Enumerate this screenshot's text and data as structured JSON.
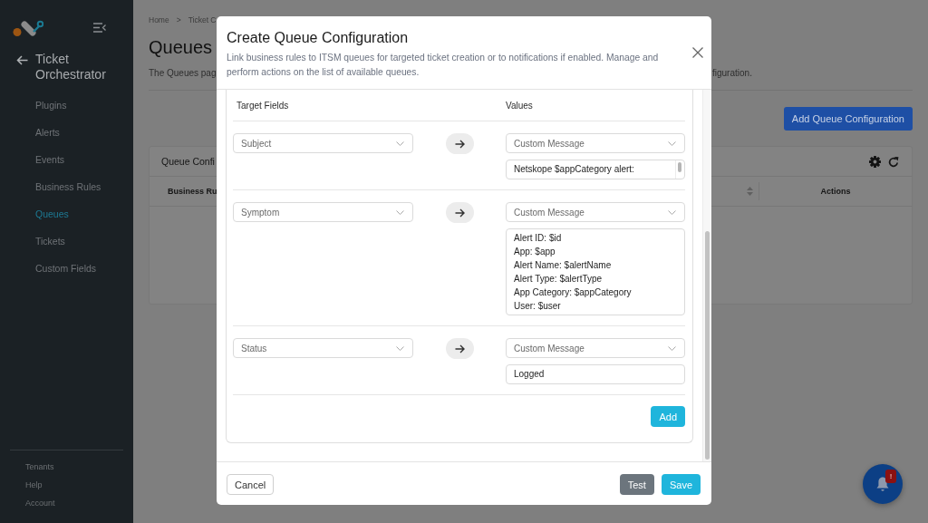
{
  "sidebar": {
    "title": "Ticket Orchestrator",
    "items": [
      {
        "label": "Plugins",
        "selected": false
      },
      {
        "label": "Alerts",
        "selected": false
      },
      {
        "label": "Events",
        "selected": false
      },
      {
        "label": "Business Rules",
        "selected": false
      },
      {
        "label": "Queues",
        "selected": true
      },
      {
        "label": "Tickets",
        "selected": false
      },
      {
        "label": "Custom Fields",
        "selected": false
      }
    ],
    "footer_items": [
      "Tenants",
      "Help",
      "Account"
    ]
  },
  "page": {
    "breadcrumb": {
      "items": [
        "Home",
        "Ticket C"
      ],
      "separator": ">"
    },
    "title": "Queues",
    "description": {
      "start": "The Queues pag",
      "end": "figuration."
    },
    "action_button": "Add Queue Configuration",
    "card": {
      "title": "Queue Confi",
      "columns": [
        {
          "label": "Business Ru",
          "sortable": false
        },
        {
          "sortable": true
        },
        {
          "label": "Actions",
          "sortable": false
        }
      ]
    }
  },
  "modal": {
    "title": "Create Queue Configuration",
    "description": "Link business rules to ITSM queues for targeted ticket creation or to notifications if enabled. Manage and perform actions on the list of available queues.",
    "columns": [
      "Target Fields",
      "Values"
    ],
    "mappings": [
      {
        "target": "Subject",
        "source": "Custom Message",
        "kind": "textarea",
        "value": "Netskope $appCategory alert:"
      },
      {
        "target": "Symptom",
        "source": "Custom Message",
        "kind": "multiline",
        "value": "Alert ID: $id\nApp: $app\nAlert Name: $alertName\nAlert Type: $alertType\nApp Category: $appCategory\nUser: $user"
      },
      {
        "target": "Status",
        "source": "Custom Message",
        "kind": "input",
        "value": "Logged"
      }
    ],
    "add_button": "Add",
    "buttons": [
      {
        "label": "Cancel",
        "kind": "secondary"
      },
      {
        "label": "Test",
        "kind": "neutral"
      },
      {
        "label": "Save",
        "kind": "primary"
      }
    ]
  },
  "notifications": {
    "badge": "!"
  }
}
